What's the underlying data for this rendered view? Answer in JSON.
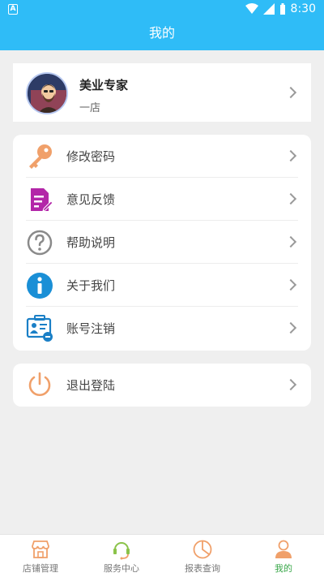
{
  "status_bar": {
    "badge": "A",
    "time": "8:30"
  },
  "header": {
    "title": "我的"
  },
  "profile": {
    "name": "美业专家",
    "shop": "一店"
  },
  "menu": [
    {
      "key": "change-password",
      "label": "修改密码",
      "icon": "key-icon"
    },
    {
      "key": "feedback",
      "label": "意见反馈",
      "icon": "feedback-document-icon"
    },
    {
      "key": "help",
      "label": "帮助说明",
      "icon": "question-mark-icon"
    },
    {
      "key": "about",
      "label": "关于我们",
      "icon": "info-icon"
    },
    {
      "key": "cancel-account",
      "label": "账号注销",
      "icon": "id-card-cancel-icon"
    }
  ],
  "logout": {
    "label": "退出登陆",
    "icon": "power-icon"
  },
  "tabs": [
    {
      "label": "店铺管理",
      "icon": "store-icon"
    },
    {
      "label": "服务中心",
      "icon": "service-icon"
    },
    {
      "label": "报表查询",
      "icon": "pie-chart-icon"
    },
    {
      "label": "我的",
      "icon": "user-icon",
      "active": true
    }
  ],
  "colors": {
    "primary": "#2fbcf7",
    "active_tab": "#3aa84a",
    "orange_icon": "#f0a06a"
  }
}
